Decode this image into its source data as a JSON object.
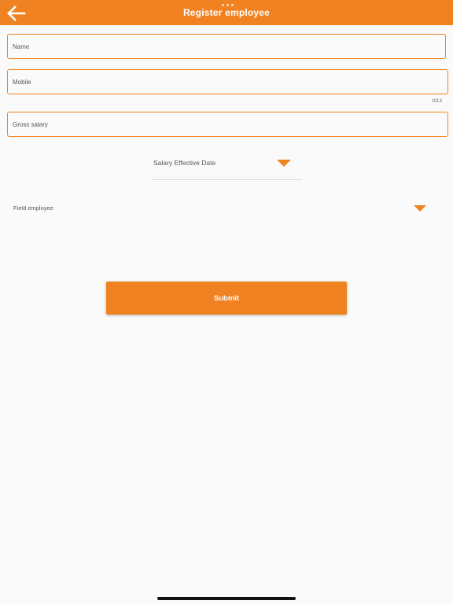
{
  "header": {
    "title": "Register employee",
    "back_icon": "arrow-left-icon",
    "color": "#f08221"
  },
  "form": {
    "name": {
      "placeholder": "Name",
      "value": ""
    },
    "mobile": {
      "placeholder": "Mobile",
      "value": "",
      "counter": "0/13"
    },
    "gross_salary": {
      "placeholder": "Gross salary",
      "value": ""
    },
    "salary_effective_date": {
      "label": "Salary Effective Date",
      "icon": "dropdown-triangle-icon"
    },
    "field_employee": {
      "label": "Field employee",
      "icon": "dropdown-triangle-icon"
    },
    "submit_label": "Submit"
  }
}
